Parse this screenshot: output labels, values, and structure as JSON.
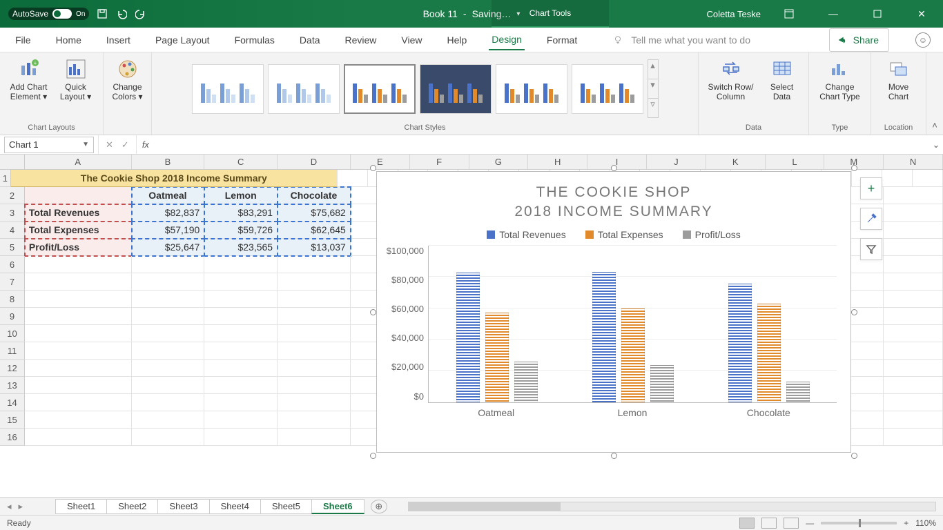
{
  "titlebar": {
    "autosave": "AutoSave",
    "autosave_state": "On",
    "doc": "Book 11",
    "saving": "Saving…",
    "tools": "Chart Tools",
    "user": "Coletta Teske"
  },
  "tabs": {
    "file": "File",
    "home": "Home",
    "insert": "Insert",
    "pagelayout": "Page Layout",
    "formulas": "Formulas",
    "data": "Data",
    "review": "Review",
    "view": "View",
    "help": "Help",
    "design": "Design",
    "format": "Format",
    "tellme_placeholder": "Tell me what you want to do",
    "share": "Share"
  },
  "ribbon": {
    "add_chart_element": "Add Chart\nElement ▾",
    "quick_layout": "Quick\nLayout ▾",
    "chart_layouts": "Chart Layouts",
    "change_colors": "Change\nColors ▾",
    "chart_styles": "Chart Styles",
    "switch_rowcol": "Switch Row/\nColumn",
    "select_data": "Select\nData",
    "data_group": "Data",
    "change_type": "Change\nChart Type",
    "type_group": "Type",
    "move_chart": "Move\nChart",
    "location_group": "Location"
  },
  "namebox": "Chart 1",
  "columns": [
    "A",
    "B",
    "C",
    "D",
    "E",
    "F",
    "G",
    "H",
    "I",
    "J",
    "K",
    "L",
    "M",
    "N"
  ],
  "rownums": [
    1,
    2,
    3,
    4,
    5,
    6,
    7,
    8,
    9,
    10,
    11,
    12,
    13,
    14,
    15,
    16
  ],
  "table": {
    "title": "The Cookie Shop 2018 Income Summary",
    "col_headers": [
      "Oatmeal",
      "Lemon",
      "Chocolate"
    ],
    "row_labels": [
      "Total Revenues",
      "Total Expenses",
      "Profit/Loss"
    ],
    "values": [
      [
        "$82,837",
        "$83,291",
        "$75,682"
      ],
      [
        "$57,190",
        "$59,726",
        "$62,645"
      ],
      [
        "$25,647",
        "$23,565",
        "$13,037"
      ]
    ]
  },
  "chart_data": {
    "type": "bar",
    "title": "THE COOKIE SHOP\n2018 INCOME SUMMARY",
    "categories": [
      "Oatmeal",
      "Lemon",
      "Chocolate"
    ],
    "series": [
      {
        "name": "Total Revenues",
        "color": "#4a72c8",
        "values": [
          82837,
          83291,
          75682
        ]
      },
      {
        "name": "Total Expenses",
        "color": "#e08a2c",
        "values": [
          57190,
          59726,
          62645
        ]
      },
      {
        "name": "Profit/Loss",
        "color": "#9c9c9c",
        "values": [
          25647,
          23565,
          13037
        ]
      }
    ],
    "yticks": [
      "$0",
      "$20,000",
      "$40,000",
      "$60,000",
      "$80,000",
      "$100,000"
    ],
    "ylim": [
      0,
      100000
    ]
  },
  "sheets": [
    "Sheet1",
    "Sheet2",
    "Sheet3",
    "Sheet4",
    "Sheet5",
    "Sheet6"
  ],
  "active_sheet": "Sheet6",
  "status": {
    "ready": "Ready",
    "zoom": "110%"
  }
}
